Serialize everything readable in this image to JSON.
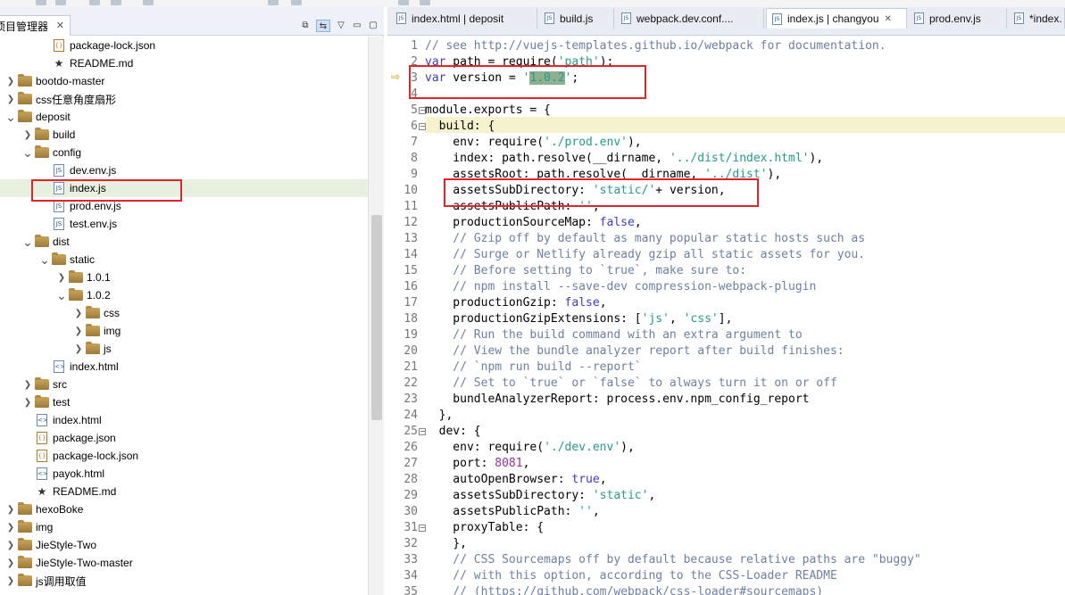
{
  "left_panel": {
    "view_title": "项目管理器",
    "tree": [
      {
        "indent": 3,
        "twisty": "",
        "icon": "json",
        "label": "package-lock.json"
      },
      {
        "indent": 3,
        "twisty": "",
        "icon": "star",
        "label": "README.md"
      },
      {
        "indent": 1,
        "twisty": ">",
        "icon": "folder",
        "label": "bootdo-master"
      },
      {
        "indent": 1,
        "twisty": ">",
        "icon": "folder",
        "label": "css任意角度扇形"
      },
      {
        "indent": 1,
        "twisty": "v",
        "icon": "folder",
        "label": "deposit"
      },
      {
        "indent": 2,
        "twisty": ">",
        "icon": "folder",
        "label": "build"
      },
      {
        "indent": 2,
        "twisty": "v",
        "icon": "folder",
        "label": "config"
      },
      {
        "indent": 3,
        "twisty": "",
        "icon": "js",
        "label": "dev.env.js"
      },
      {
        "indent": 3,
        "twisty": "",
        "icon": "js",
        "label": "index.js",
        "selected": true
      },
      {
        "indent": 3,
        "twisty": "",
        "icon": "js",
        "label": "prod.env.js"
      },
      {
        "indent": 3,
        "twisty": "",
        "icon": "js",
        "label": "test.env.js"
      },
      {
        "indent": 2,
        "twisty": "v",
        "icon": "folder",
        "label": "dist"
      },
      {
        "indent": 3,
        "twisty": "v",
        "icon": "folder",
        "label": "static"
      },
      {
        "indent": 4,
        "twisty": ">",
        "icon": "folder",
        "label": "1.0.1"
      },
      {
        "indent": 4,
        "twisty": "v",
        "icon": "folder",
        "label": "1.0.2"
      },
      {
        "indent": 5,
        "twisty": ">",
        "icon": "folder",
        "label": "css"
      },
      {
        "indent": 5,
        "twisty": ">",
        "icon": "folder",
        "label": "img"
      },
      {
        "indent": 5,
        "twisty": ">",
        "icon": "folder",
        "label": "js"
      },
      {
        "indent": 3,
        "twisty": "",
        "icon": "html",
        "label": "index.html"
      },
      {
        "indent": 2,
        "twisty": ">",
        "icon": "folder",
        "label": "src"
      },
      {
        "indent": 2,
        "twisty": ">",
        "icon": "folder",
        "label": "test"
      },
      {
        "indent": 2,
        "twisty": "",
        "icon": "html",
        "label": "index.html"
      },
      {
        "indent": 2,
        "twisty": "",
        "icon": "json",
        "label": "package.json"
      },
      {
        "indent": 2,
        "twisty": "",
        "icon": "json",
        "label": "package-lock.json"
      },
      {
        "indent": 2,
        "twisty": "",
        "icon": "html",
        "label": "payok.html"
      },
      {
        "indent": 2,
        "twisty": "",
        "icon": "star",
        "label": "README.md"
      },
      {
        "indent": 1,
        "twisty": ">",
        "icon": "folder",
        "label": "hexoBoke"
      },
      {
        "indent": 1,
        "twisty": ">",
        "icon": "folder",
        "label": "img"
      },
      {
        "indent": 1,
        "twisty": ">",
        "icon": "folder",
        "label": "JieStyle-Two"
      },
      {
        "indent": 1,
        "twisty": ">",
        "icon": "folder",
        "label": "JieStyle-Two-master"
      },
      {
        "indent": 1,
        "twisty": ">",
        "icon": "folder",
        "label": "js调用取值"
      }
    ]
  },
  "editor": {
    "tabs": [
      {
        "label": "index.html | deposit",
        "active": false
      },
      {
        "label": "build.js",
        "active": false
      },
      {
        "label": "webpack.dev.conf....",
        "active": false
      },
      {
        "label": "index.js | changyou",
        "active": true
      },
      {
        "label": "prod.env.js",
        "active": false
      },
      {
        "label": "*index.",
        "active": false
      }
    ],
    "lines": [
      {
        "n": "1",
        "fold": "",
        "tokens": [
          [
            "cm",
            "// see http://vuejs-templates.github.io/webpack for documentation."
          ]
        ]
      },
      {
        "n": "2",
        "fold": "",
        "tokens": [
          [
            "kw",
            "var"
          ],
          [
            "",
            " path = require("
          ],
          [
            "str",
            "'path'"
          ],
          [
            "",
            ");"
          ]
        ]
      },
      {
        "n": "3",
        "fold": "",
        "tokens": [
          [
            "kw",
            "var"
          ],
          [
            "",
            " version = "
          ],
          [
            "str",
            "'"
          ],
          [
            "sel",
            "1.0.2"
          ],
          [
            "str",
            "'"
          ],
          [
            "",
            ";"
          ]
        ]
      },
      {
        "n": "4",
        "fold": "",
        "tokens": []
      },
      {
        "n": "5",
        "fold": "−",
        "tokens": [
          [
            "",
            "module.exports = {"
          ]
        ]
      },
      {
        "n": "6",
        "fold": "−",
        "tokens": [
          [
            "",
            "  build: {"
          ]
        ]
      },
      {
        "n": "7",
        "fold": "",
        "tokens": [
          [
            "",
            "    env: require("
          ],
          [
            "str",
            "'./prod.env'"
          ],
          [
            "",
            "),"
          ]
        ]
      },
      {
        "n": "8",
        "fold": "",
        "tokens": [
          [
            "",
            "    index: path.resolve(__dirname, "
          ],
          [
            "str",
            "'../dist/index.html'"
          ],
          [
            "",
            "),"
          ]
        ]
      },
      {
        "n": "9",
        "fold": "",
        "tokens": [
          [
            "",
            "    assetsRoot: path.resolve(__dirname, "
          ],
          [
            "str",
            "'../dist'"
          ],
          [
            "",
            "),"
          ]
        ]
      },
      {
        "n": "10",
        "fold": "",
        "tokens": [
          [
            "",
            "    assetsSubDirectory: "
          ],
          [
            "str",
            "'static/'"
          ],
          [
            "",
            "+ version,"
          ]
        ]
      },
      {
        "n": "11",
        "fold": "",
        "tokens": [
          [
            "",
            "    assetsPublicPath: "
          ],
          [
            "str",
            "''"
          ],
          [
            "",
            ","
          ]
        ]
      },
      {
        "n": "12",
        "fold": "",
        "tokens": [
          [
            "",
            "    productionSourceMap: "
          ],
          [
            "kw",
            "false"
          ],
          [
            "",
            ","
          ]
        ]
      },
      {
        "n": "13",
        "fold": "",
        "tokens": [
          [
            "cm",
            "    // Gzip off by default as many popular static hosts such as"
          ]
        ]
      },
      {
        "n": "14",
        "fold": "",
        "tokens": [
          [
            "cm",
            "    // Surge or Netlify already gzip all static assets for you."
          ]
        ]
      },
      {
        "n": "15",
        "fold": "",
        "tokens": [
          [
            "cm",
            "    // Before setting to `true`, make sure to:"
          ]
        ]
      },
      {
        "n": "16",
        "fold": "",
        "tokens": [
          [
            "cm",
            "    // npm install --save-dev compression-webpack-plugin"
          ]
        ]
      },
      {
        "n": "17",
        "fold": "",
        "tokens": [
          [
            "",
            "    productionGzip: "
          ],
          [
            "kw",
            "false"
          ],
          [
            "",
            ","
          ]
        ]
      },
      {
        "n": "18",
        "fold": "",
        "tokens": [
          [
            "",
            "    productionGzipExtensions: ["
          ],
          [
            "str",
            "'js'"
          ],
          [
            "",
            ", "
          ],
          [
            "str",
            "'css'"
          ],
          [
            "",
            "],"
          ]
        ]
      },
      {
        "n": "19",
        "fold": "",
        "tokens": [
          [
            "cm",
            "    // Run the build command with an extra argument to"
          ]
        ]
      },
      {
        "n": "20",
        "fold": "",
        "tokens": [
          [
            "cm",
            "    // View the bundle analyzer report after build finishes:"
          ]
        ]
      },
      {
        "n": "21",
        "fold": "",
        "tokens": [
          [
            "cm",
            "    // `npm run build --report`"
          ]
        ]
      },
      {
        "n": "22",
        "fold": "",
        "tokens": [
          [
            "cm",
            "    // Set to `true` or `false` to always turn it on or off"
          ]
        ]
      },
      {
        "n": "23",
        "fold": "",
        "tokens": [
          [
            "",
            "    bundleAnalyzerReport: process.env.npm_config_report"
          ]
        ]
      },
      {
        "n": "24",
        "fold": "",
        "tokens": [
          [
            "",
            "  },"
          ]
        ]
      },
      {
        "n": "25",
        "fold": "−",
        "tokens": [
          [
            "",
            "  dev: {"
          ]
        ]
      },
      {
        "n": "26",
        "fold": "",
        "tokens": [
          [
            "",
            "    env: require("
          ],
          [
            "str",
            "'./dev.env'"
          ],
          [
            "",
            "),"
          ]
        ]
      },
      {
        "n": "27",
        "fold": "",
        "tokens": [
          [
            "",
            "    port: "
          ],
          [
            "num",
            "8081"
          ],
          [
            "",
            ","
          ]
        ]
      },
      {
        "n": "28",
        "fold": "",
        "tokens": [
          [
            "",
            "    autoOpenBrowser: "
          ],
          [
            "kw",
            "true"
          ],
          [
            "",
            ","
          ]
        ]
      },
      {
        "n": "29",
        "fold": "",
        "tokens": [
          [
            "",
            "    assetsSubDirectory: "
          ],
          [
            "str",
            "'static'"
          ],
          [
            "",
            ","
          ]
        ]
      },
      {
        "n": "30",
        "fold": "",
        "tokens": [
          [
            "",
            "    assetsPublicPath: "
          ],
          [
            "str",
            "''"
          ],
          [
            "",
            ","
          ]
        ]
      },
      {
        "n": "31",
        "fold": "−",
        "tokens": [
          [
            "",
            "    proxyTable: {"
          ]
        ]
      },
      {
        "n": "32",
        "fold": "",
        "tokens": [
          [
            "",
            "    },"
          ]
        ]
      },
      {
        "n": "33",
        "fold": "",
        "tokens": [
          [
            "cm",
            "    // CSS Sourcemaps off by default because relative paths are \"buggy\""
          ]
        ]
      },
      {
        "n": "34",
        "fold": "",
        "tokens": [
          [
            "cm",
            "    // with this option, according to the CSS-Loader README"
          ]
        ]
      },
      {
        "n": "35",
        "fold": "",
        "tokens": [
          [
            "cm",
            "    // (https://github.com/webpack/css-loader#sourcemaps)"
          ]
        ]
      }
    ]
  },
  "colors": {
    "annotation": "#e0262a",
    "keyword": "#3c3cc8",
    "string": "#2a9a8a",
    "comment": "#6f7fa0",
    "selection": "#8fb08f"
  }
}
